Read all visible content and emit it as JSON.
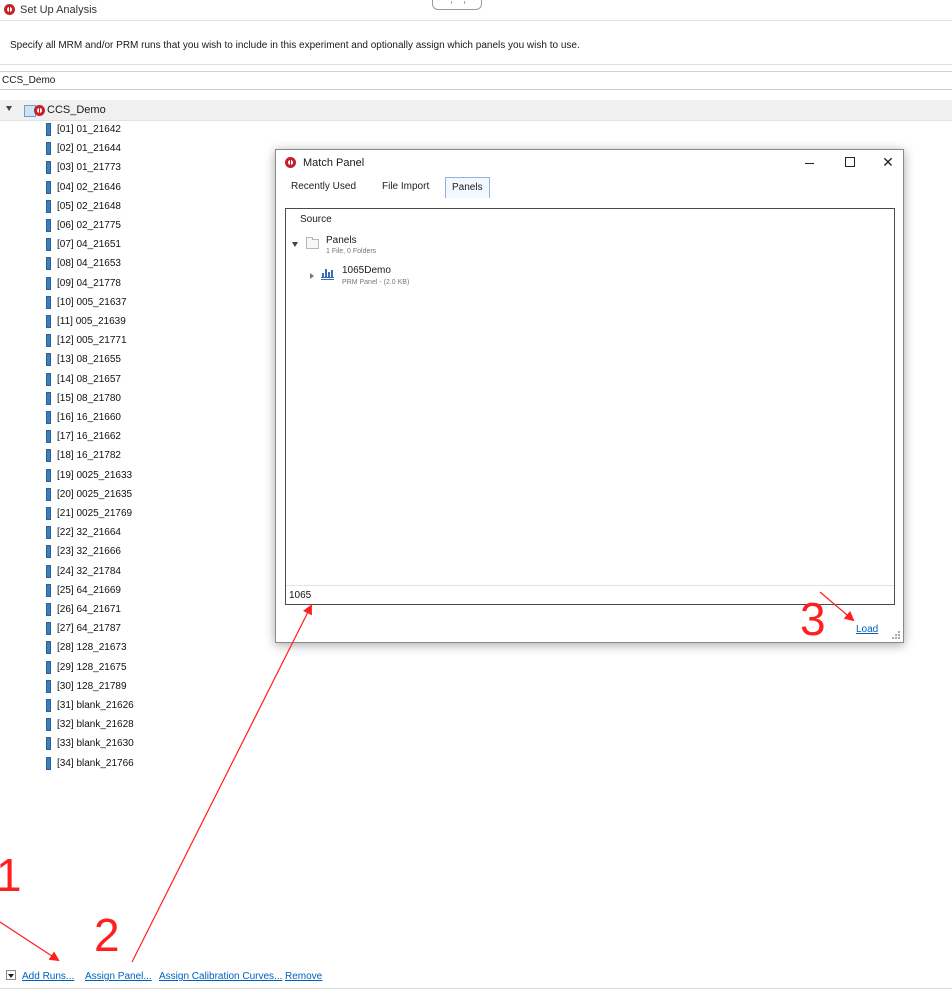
{
  "window": {
    "title": "Set Up Analysis"
  },
  "instructions": "Specify all MRM and/or PRM runs that you wish to include in this experiment and optionally assign which panels you wish to use.",
  "experiment_name": "CCS_Demo",
  "tree": {
    "root_label": "CCS_Demo",
    "runs": [
      "[01] 01_21642",
      "[02] 01_21644",
      "[03] 01_21773",
      "[04] 02_21646",
      "[05] 02_21648",
      "[06] 02_21775",
      "[07] 04_21651",
      "[08] 04_21653",
      "[09] 04_21778",
      "[10] 005_21637",
      "[11] 005_21639",
      "[12] 005_21771",
      "[13] 08_21655",
      "[14] 08_21657",
      "[15] 08_21780",
      "[16] 16_21660",
      "[17] 16_21662",
      "[18] 16_21782",
      "[19] 0025_21633",
      "[20] 0025_21635",
      "[21] 0025_21769",
      "[22] 32_21664",
      "[23] 32_21666",
      "[24] 32_21784",
      "[25] 64_21669",
      "[26] 64_21671",
      "[27] 64_21787",
      "[28] 128_21673",
      "[29] 128_21675",
      "[30] 128_21789",
      "[31] blank_21626",
      "[32] blank_21628",
      "[33] blank_21630",
      "[34] blank_21766"
    ]
  },
  "toolbar": {
    "add_runs": "Add Runs...",
    "assign_panel": "Assign Panel...",
    "assign_calibration": "Assign Calibration Curves...",
    "remove": "Remove"
  },
  "dialog": {
    "title": "Match Panel",
    "close_glyph": "✕",
    "tabs": [
      {
        "label": "Recently Used",
        "selected": false
      },
      {
        "label": "File Import",
        "selected": false
      },
      {
        "label": "Panels",
        "selected": true
      }
    ],
    "source_header": "Source",
    "folder": {
      "name": "Panels",
      "meta": "1 File, 0 Folders"
    },
    "panel": {
      "name": "1065Demo",
      "meta": "PRM Panel - (2.0 KB)"
    },
    "search_value": "1065",
    "load_label": "Load"
  },
  "annotations": {
    "step1": "1",
    "step2": "2",
    "step3": "3"
  },
  "colors": {
    "accent_link": "#0060c0",
    "annotation": "#ff1f1f",
    "app_icon": "#c8202a",
    "vial": "#3b7fc2"
  }
}
